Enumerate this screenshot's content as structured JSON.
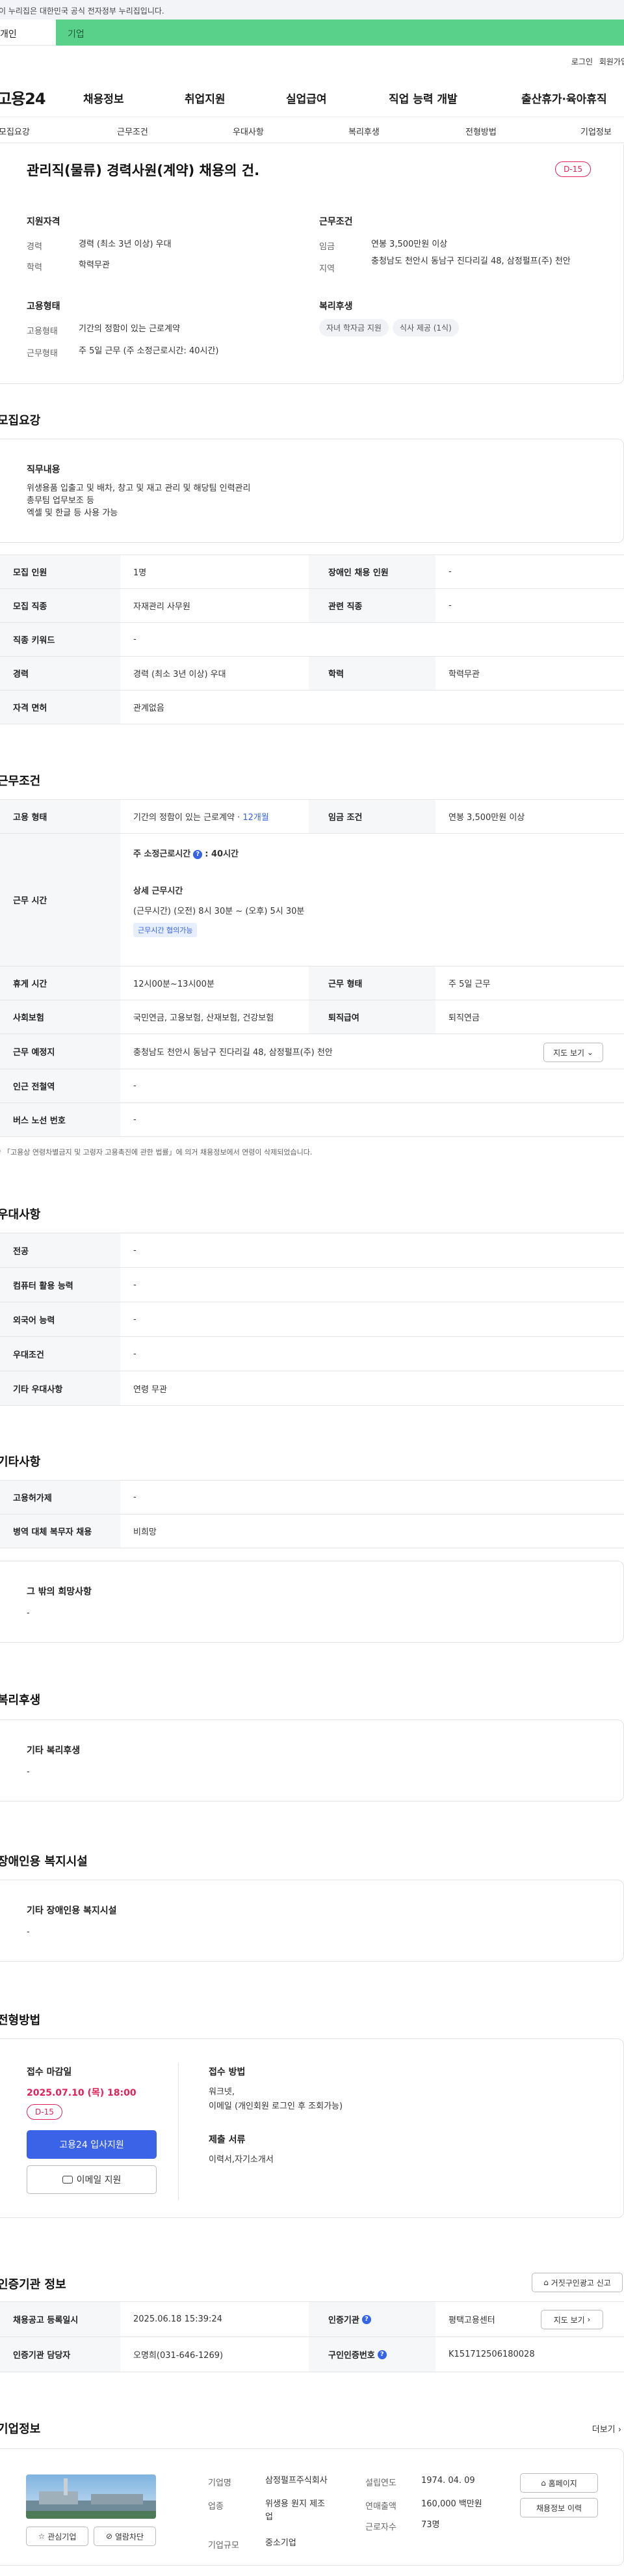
{
  "gov_banner": "이 누리집은 대한민국 공식 전자정부 누리집입니다.",
  "user_tabs": {
    "person": "개인",
    "biz": "기업"
  },
  "util": {
    "login": "로그인",
    "join": "회원가입"
  },
  "logo": "고용24",
  "gnb": [
    "채용정보",
    "취업지원",
    "실업급여",
    "직업 능력 개발",
    "출산휴가·육아휴직"
  ],
  "anchors": [
    "모집요강",
    "근무조건",
    "우대사항",
    "복리후생",
    "전형방법",
    "기업정보"
  ],
  "title": "관리직(물류) 경력사원(계약) 채용의 건.",
  "dday": "D-15",
  "summary": {
    "qual_h": "지원자격",
    "career_k": "경력",
    "career_v": "경력 (최소 3년 이상) 우대",
    "edu_k": "학력",
    "edu_v": "학력무관",
    "emp_h": "고용형태",
    "emptype_k": "고용형태",
    "emptype_v": "기간의 정함이 있는 근로계약",
    "worktype_k": "근무형태",
    "worktype_v": "주 5일 근무 (주 소정근로시간: 40시간)",
    "cond_h": "근무조건",
    "wage_k": "임금",
    "wage_v": "연봉 3,500만원 이상",
    "area_k": "지역",
    "area_v": "충청남도 천안시 동남구 진다리길 48, 삼정펄프(주) 천안",
    "welfare_h": "복리후생",
    "chips": [
      "자녀 학자금 지원",
      "식사 제공 (1식)"
    ]
  },
  "recruit": {
    "heading": "모집요강",
    "duty_title": "직무내용",
    "duty_lines": [
      "위생용품 입출고 및 배차, 창고 및 재고 관리 및 해당팀 인력관리",
      "총무팀 업무보조 등",
      "엑셀 및 한글 등 사용 가능"
    ],
    "rows": [
      {
        "k1": "모집 인원",
        "v1": "1명",
        "k2": "장애인 채용 인원",
        "v2": "-"
      },
      {
        "k1": "모집 직종",
        "v1": "자재관리 사무원",
        "k2": "관련 직종",
        "v2": "-"
      },
      {
        "k1": "직종 키워드",
        "v1": "-"
      },
      {
        "k1": "경력",
        "v1": "경력 (최소 3년 이상) 우대",
        "k2": "학력",
        "v2": "학력무관"
      },
      {
        "k1": "자격 면허",
        "v1": "관계없음"
      }
    ]
  },
  "work": {
    "heading": "근무조건",
    "emp_k": "고용 형태",
    "emp_v": "기간의 정함이 있는 근로계약 · ",
    "emp_period": "12개월",
    "wage_k": "임금 조건",
    "wage_v": "연봉 3,500만원 이상",
    "hours_k": "근무 시간",
    "hours_h1": "주 소정근로시간",
    "hours_h1_v": ": 40시간",
    "hours_h2": "상세 근무시간",
    "hours_l1": "(근무시간) (오전) 8시 30분 ~ (오후) 5시 30분",
    "hours_badge": "근무시간 협의가능",
    "rest_k": "휴게 시간",
    "rest_v": "12시00분~13시00분",
    "form_k": "근무 형태",
    "form_v": "주 5일 근무",
    "ins_k": "사회보험",
    "ins_v": "국민연금, 고용보험, 산재보험, 건강보험",
    "ret_k": "퇴직급여",
    "ret_v": "퇴직연금",
    "place_k": "근무 예정지",
    "place_v": "충청남도 천안시 동남구 진다리길 48, 삼정펄프(주) 천안",
    "map_btn": "지도 보기",
    "subway_k": "인근 전철역",
    "subway_v": "-",
    "bus_k": "버스 노선 번호",
    "bus_v": "-",
    "note": "* 「고용상 연령차별금지 및 고령자 고용촉진에 관한 법률」에 의거 채용정보에서 연령이 삭제되었습니다."
  },
  "pref": {
    "heading": "우대사항",
    "rows": [
      {
        "k": "전공",
        "v": "-"
      },
      {
        "k": "컴퓨터 활용 능력",
        "v": "-"
      },
      {
        "k": "외국어 능력",
        "v": "-"
      },
      {
        "k": "우대조건",
        "v": "-"
      },
      {
        "k": "기타 우대사항",
        "v": "연령 무관"
      }
    ]
  },
  "etc": {
    "heading": "기타사항",
    "rows": [
      {
        "k": "고용허가제",
        "v": "-"
      },
      {
        "k": "병역 대체 복무자 채용",
        "v": "비희망"
      }
    ],
    "other_title": "그 밖의 희망사항",
    "other_v": "-"
  },
  "welfare": {
    "heading": "복리후생",
    "title": "기타 복리후생",
    "v": "-"
  },
  "disabled": {
    "heading": "장애인용 복지시설",
    "title": "기타 장애인용 복지시설",
    "v": "-"
  },
  "process": {
    "heading": "전형방법",
    "deadline_t": "접수 마감일",
    "deadline_v": "2025.07.10 (목) 18:00",
    "dday": "D-15",
    "apply_btn": "고용24 입사지원",
    "mail_btn": "이메일 지원",
    "method_t": "접수 방법",
    "method_l1": "워크넷,",
    "method_l2": "이메일 (개인회원 로그인 후 조회가능)",
    "docs_t": "제출 서류",
    "docs_v": "이력서,자기소개서"
  },
  "agency": {
    "heading": "인증기관 정보",
    "report_btn": "거짓구인광고 신고",
    "reg_k": "채용공고 등록일시",
    "reg_v": "2025.06.18 15:39:24",
    "org_k": "인증기관",
    "org_v": "평택고용센터",
    "map_btn": "지도 보기",
    "mgr_k": "인증기관 담당자",
    "mgr_v": "오명희(031-646-1269)",
    "no_k": "구인인증번호",
    "no_v": "K151712506180028"
  },
  "company": {
    "heading": "기업정보",
    "more": "더보기",
    "fav_btn": "관심기업",
    "block_btn": "열람차단",
    "name_k": "기업명",
    "name_v": "삼정펄프주식회사",
    "ind_k": "업종",
    "ind_v1": "위생용 원지 제조",
    "ind_v2": "업",
    "size_k": "기업규모",
    "size_v": "중소기업",
    "est_k": "설립연도",
    "est_v": "1974. 04. 09",
    "sales_k": "연매출액",
    "sales_v": "160,000 백만원",
    "emp_k": "근로자수",
    "emp_v": "73명",
    "home_btn": "홈페이지",
    "history_btn": "채용정보 이력"
  }
}
